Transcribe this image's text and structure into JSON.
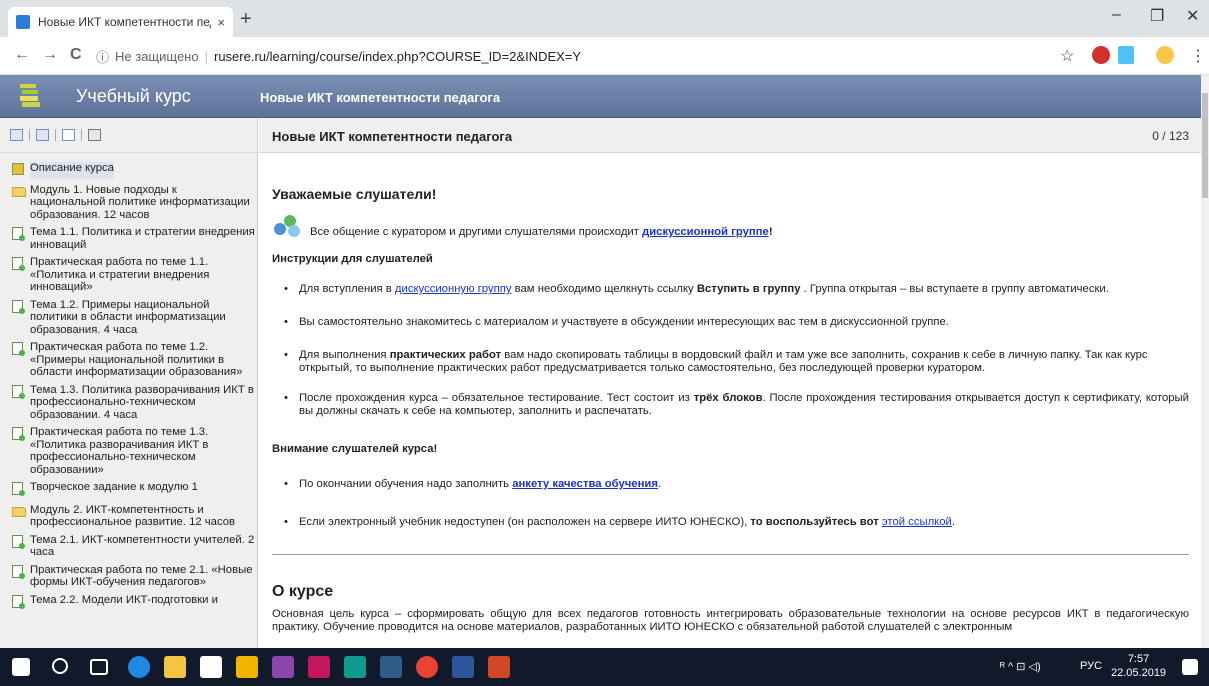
{
  "browser": {
    "tab_title": "Новые ИКТ компетентности пед",
    "tab_close": "×",
    "new_tab": "+",
    "minimize": "–",
    "restore": "❐",
    "close": "✕",
    "back": "←",
    "forward": "→",
    "reload": "C",
    "info": "ⓘ",
    "security": "Не защищено",
    "url": "rusere.ru/learning/course/index.php?COURSE_ID=2&INDEX=Y",
    "star": "☆",
    "menu": "⋮"
  },
  "site": {
    "title": "Учебный курс",
    "course_title": "Новые ИКТ компетентности педагога"
  },
  "sidebar": {
    "items": [
      {
        "label": "Описание курса",
        "icon": "description-icon"
      },
      {
        "label": "Модуль 1. Новые подходы к национальной политике информатизации образования. 12 часов",
        "icon": "folder-icon"
      },
      {
        "label": "Тема 1.1. Политика и стратегии внедрения инноваций",
        "icon": "page-icon"
      },
      {
        "label": "Практическая работа по теме 1.1. «Политика и стратегии внедрения инноваций»",
        "icon": "page-icon"
      },
      {
        "label": "Тема 1.2. Примеры национальной политики в области информатизации образования. 4 часа",
        "icon": "page-icon"
      },
      {
        "label": "Практическая работа по теме 1.2. «Примеры национальной политики в области информатизации образования»",
        "icon": "page-icon"
      },
      {
        "label": "Тема 1.3. Политика разворачивания ИКТ в профессионально-техническом образовании. 4 часа",
        "icon": "page-icon"
      },
      {
        "label": "Практическая работа по теме 1.3. «Политика разворачивания ИКТ в профессионально-техническом образовании»",
        "icon": "page-icon"
      },
      {
        "label": "Творческое задание к модулю 1",
        "icon": "page-icon"
      },
      {
        "label": "Модуль 2. ИКТ-компетентность и профессиональное развитие. 12 часов",
        "icon": "folder-icon"
      },
      {
        "label": "Тема 2.1. ИКТ-компетентности учителей. 2 часа",
        "icon": "page-icon"
      },
      {
        "label": "Практическая работа по теме 2.1. «Новые формы ИКТ-обучения педагогов»",
        "icon": "page-icon"
      },
      {
        "label": "Тема 2.2. Модели ИКТ-подготовки и",
        "icon": "page-icon"
      }
    ]
  },
  "main": {
    "title": "Новые ИКТ компетентности педагога",
    "counter": "0 / 123",
    "greeting": "Уважаемые слушатели!",
    "chat_text": "Все общение с куратором и другими слушателями происходит ",
    "chat_link": "дискуссионной группе",
    "chat_end": "!",
    "instructions_heading": "Инструкции для слушателей",
    "b1_pre": "Для вступления в ",
    "b1_link": "дискуссионную группу",
    "b1_mid": " вам необходимо щелкнуть ссылку ",
    "b1_bold": "Вступить в группу",
    "b1_post": " . Группа открытая – вы вступаете в группу автоматически.",
    "b2": "Вы самостоятельно знакомитесь с материалом и участвуете в обсуждении интересующих вас тем в дискуссионной группе.",
    "b3_pre": "Для выполнения ",
    "b3_bold": "практических работ",
    "b3_post": " вам надо скопировать таблицы в вордовский файл и там уже все заполнить, сохранив к себе в личную папку. Так как курс открытый, то выполнение практических работ предусматривается только самостоятельно, без последующей проверки куратором.",
    "b4_pre": "После прохождения курса – обязательное тестирование. Тест состоит из ",
    "b4_bold": "трёх блоков",
    "b4_post": ". После прохождения тестирования открывается доступ к сертификату, который вы должны скачать к себе на компьютер, заполнить и распечатать.",
    "attention_heading": "Внимание слушателей курса!",
    "a1_pre": "По окончании обучения надо заполнить ",
    "a1_link": "анкету качества обучения",
    "a1_post": ".",
    "a2_pre": "Если электронный учебник недоступен (он расположен на сервере ИИТО ЮНЕСКО), ",
    "a2_bold": "то воспользуйтесь вот ",
    "a2_link": "этой ссылкой",
    "a2_post": ".",
    "about_heading": "О курсе",
    "about_text": "Основная цель курса – сформировать общую для всех педагогов готовность интегрировать образовательные технологии на основе ресурсов ИКТ в педагогическую практику. Обучение проводится на основе материалов, разработанных ИИТО ЮНЕСКО с обязательной работой слушателей с электронным"
  },
  "taskbar": {
    "lang": "РУС",
    "time": "7:57",
    "date": "22.05.2019",
    "tray_icons": "ᴿ ^ ⊡ ◁)"
  }
}
